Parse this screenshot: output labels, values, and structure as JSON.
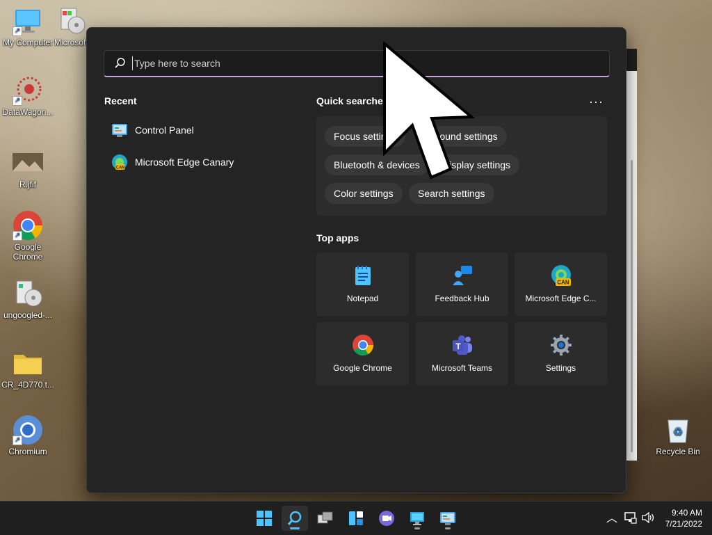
{
  "desktop": {
    "icons": [
      {
        "label": "My Computer"
      },
      {
        "label": "Microsoft"
      },
      {
        "label": "DataWagon..."
      },
      {
        "label": "R.jfif"
      },
      {
        "label": "Google Chrome"
      },
      {
        "label": "ungoogled-..."
      },
      {
        "label": "CR_4D770.t..."
      },
      {
        "label": "Chromium"
      },
      {
        "label": "Recycle Bin"
      }
    ]
  },
  "start": {
    "search": {
      "placeholder": "Type here to search"
    },
    "recent": {
      "title": "Recent",
      "items": [
        {
          "label": "Control Panel",
          "icon": "control-panel-icon"
        },
        {
          "label": "Microsoft Edge Canary",
          "icon": "edge-canary-icon"
        }
      ]
    },
    "quick_searches": {
      "title": "Quick searches",
      "more": "···",
      "chips": [
        {
          "label": "Focus settings"
        },
        {
          "label": "Sound settings"
        },
        {
          "label": "Bluetooth & devices"
        },
        {
          "label": "Display settings"
        },
        {
          "label": "Color settings"
        },
        {
          "label": "Search settings"
        }
      ]
    },
    "top_apps": {
      "title": "Top apps",
      "apps": [
        {
          "label": "Notepad",
          "icon": "notepad-icon"
        },
        {
          "label": "Feedback Hub",
          "icon": "feedback-hub-icon"
        },
        {
          "label": "Microsoft Edge C...",
          "icon": "edge-canary-icon"
        },
        {
          "label": "Google Chrome",
          "icon": "chrome-icon"
        },
        {
          "label": "Microsoft Teams",
          "icon": "teams-icon"
        },
        {
          "label": "Settings",
          "icon": "settings-icon"
        }
      ]
    }
  },
  "taskbar": {
    "clock": {
      "time": "9:40 AM",
      "date": "7/21/2022"
    }
  },
  "colors": {
    "accent": "#c9a7de",
    "panel": "#242424",
    "tile": "#2c2c2c"
  }
}
